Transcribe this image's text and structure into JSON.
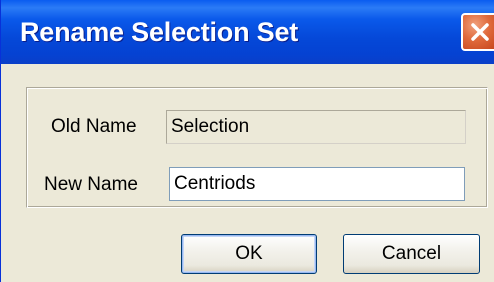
{
  "dialog": {
    "title": "Rename Selection Set",
    "close_icon": "close-x-icon"
  },
  "form": {
    "old_name_label": "Old Name",
    "old_name_value": "Selection",
    "new_name_label": "New Name",
    "new_name_value": "Centriods"
  },
  "buttons": {
    "ok_label": "OK",
    "cancel_label": "Cancel"
  },
  "colors": {
    "titlebar": "#0548d8",
    "close_button": "#d9582c",
    "dialog_background": "#ece9d8",
    "input_border": "#7f9db9"
  }
}
